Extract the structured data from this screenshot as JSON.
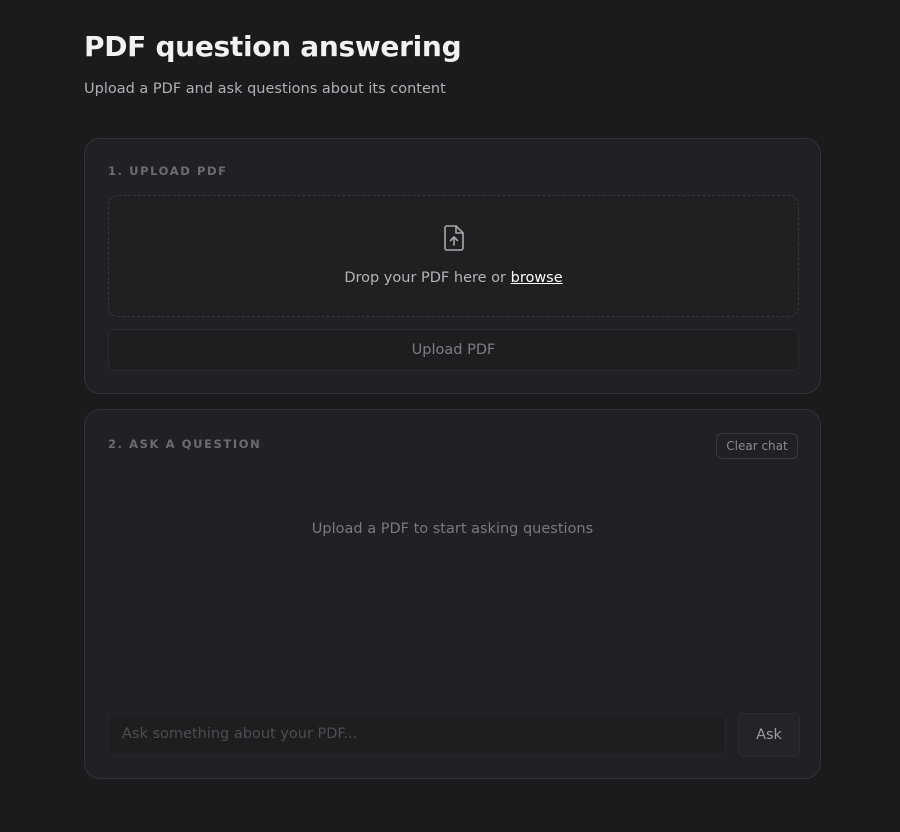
{
  "header": {
    "title": "PDF question answering",
    "subtitle": "Upload a PDF and ask questions about its content"
  },
  "upload_section": {
    "label": "1. UPLOAD PDF",
    "icon": "file-upload-icon",
    "drop_text": "Drop your PDF here or",
    "browse_label": "browse",
    "upload_button": "Upload PDF"
  },
  "ask_section": {
    "label": "2. ASK A QUESTION",
    "clear_button": "Clear chat",
    "empty_message": "Upload a PDF to start asking questions",
    "input_placeholder": "Ask something about your PDF...",
    "input_value": "",
    "ask_button": "Ask"
  },
  "colors": {
    "background": "#1b1a1d",
    "card": "#212024",
    "text": "#e8e8ea",
    "muted": "#6c6b72"
  }
}
